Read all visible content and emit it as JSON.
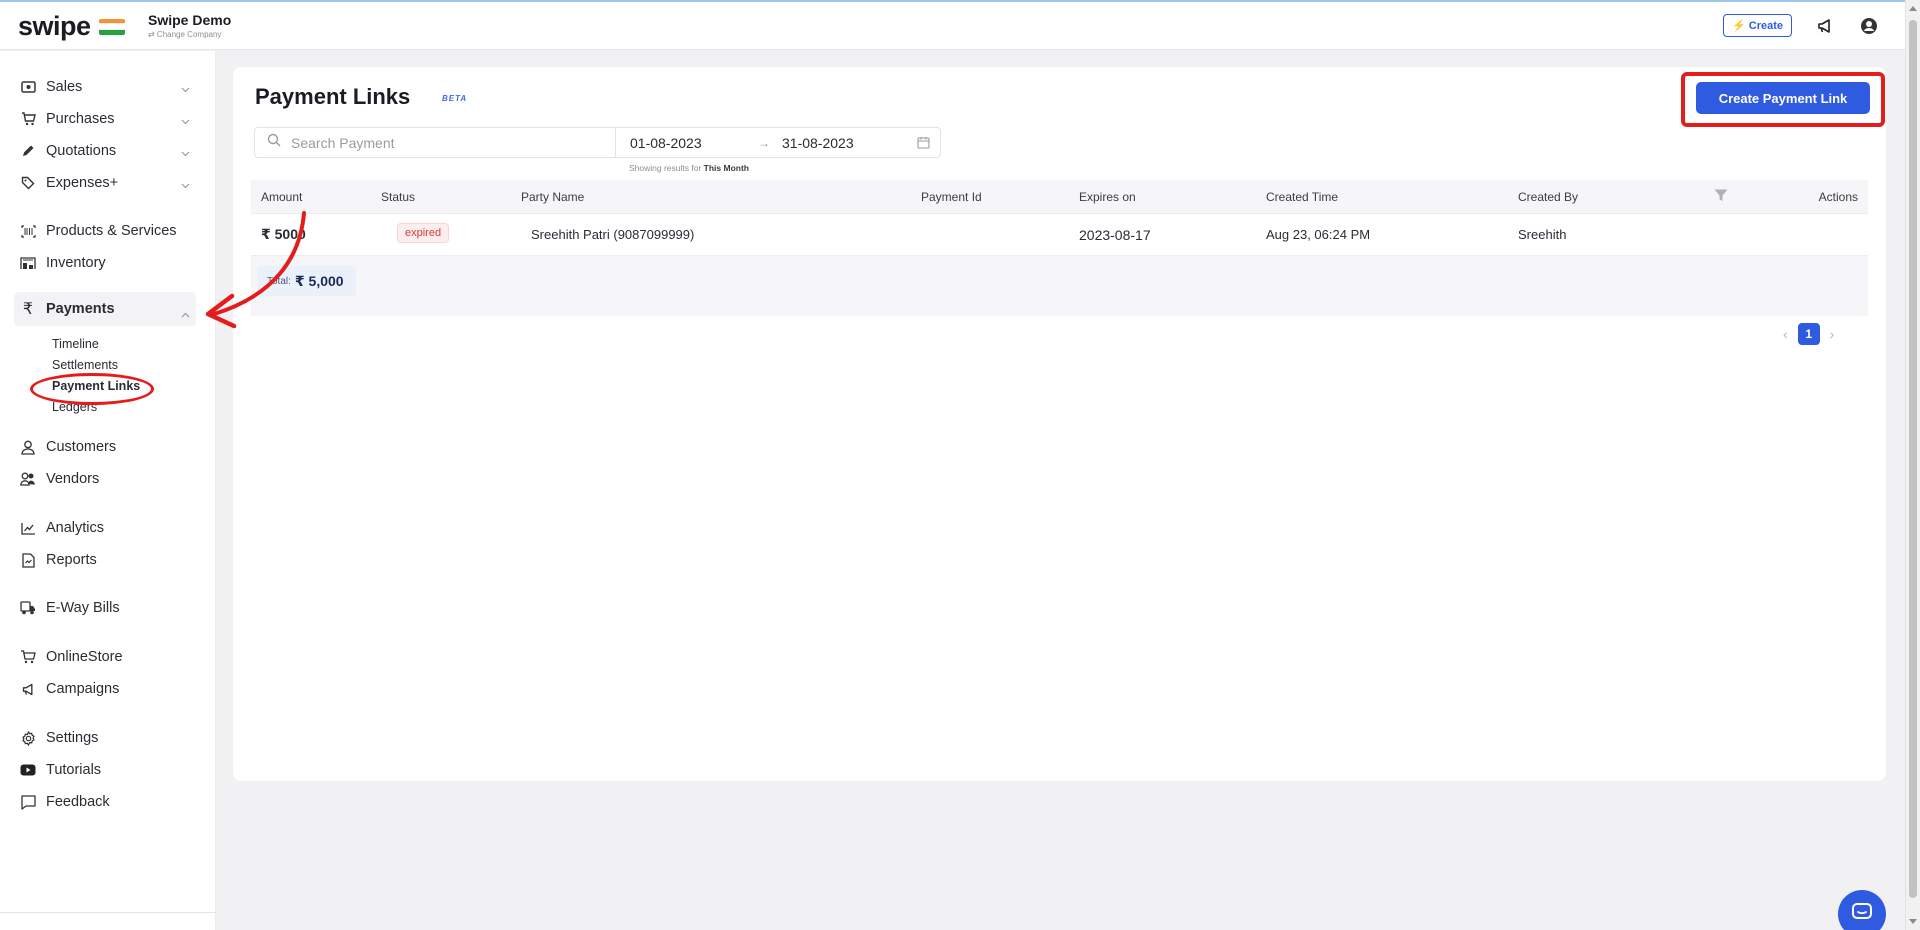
{
  "brand": {
    "logo_text": "swipe",
    "company_name": "Swipe Demo",
    "change_company": "⇄ Change Company",
    "flag_colors": [
      "#f39433",
      "#ffffff",
      "#25a244"
    ]
  },
  "topbar": {
    "create_label": "Create"
  },
  "sidebar": {
    "sales": "Sales",
    "purchases": "Purchases",
    "quotations": "Quotations",
    "expenses": "Expenses+",
    "products": "Products & Services",
    "inventory": "Inventory",
    "payments": "Payments",
    "payments_sub": {
      "timeline": "Timeline",
      "settlements": "Settlements",
      "payment_links": "Payment Links",
      "ledgers": "Ledgers"
    },
    "customers": "Customers",
    "vendors": "Vendors",
    "analytics": "Analytics",
    "reports": "Reports",
    "eway": "E-Way Bills",
    "onlinestore": "OnlineStore",
    "campaigns": "Campaigns",
    "settings": "Settings",
    "tutorials": "Tutorials",
    "feedback": "Feedback"
  },
  "page": {
    "title": "Payment Links",
    "beta": "BETA",
    "create_button": "Create Payment Link",
    "search_placeholder": "Search Payment",
    "date_from": "01-08-2023",
    "date_arrow": "→",
    "date_to": "31-08-2023",
    "showing_prefix": "Showing results for",
    "showing_period": "This Month"
  },
  "table": {
    "headers": {
      "amount": "Amount",
      "status": "Status",
      "party": "Party Name",
      "payment_id": "Payment Id",
      "expires": "Expires on",
      "created_time": "Created Time",
      "created_by": "Created By",
      "actions": "Actions"
    },
    "rows": [
      {
        "amount": "₹ 5000",
        "status": "expired",
        "party": "Sreehith Patri (9087099999)",
        "payment_id": "",
        "expires": "2023-08-17",
        "created_time": "Aug 23, 06:24 PM",
        "created_by": "Sreehith"
      }
    ],
    "total_label": "Total:",
    "total_value": "₹ 5,000"
  },
  "pagination": {
    "prev": "‹",
    "current": "1",
    "next": "›"
  },
  "colors": {
    "primary": "#2f5be0",
    "annotation": "#e31c1c",
    "expired_text": "#d23b3b"
  }
}
